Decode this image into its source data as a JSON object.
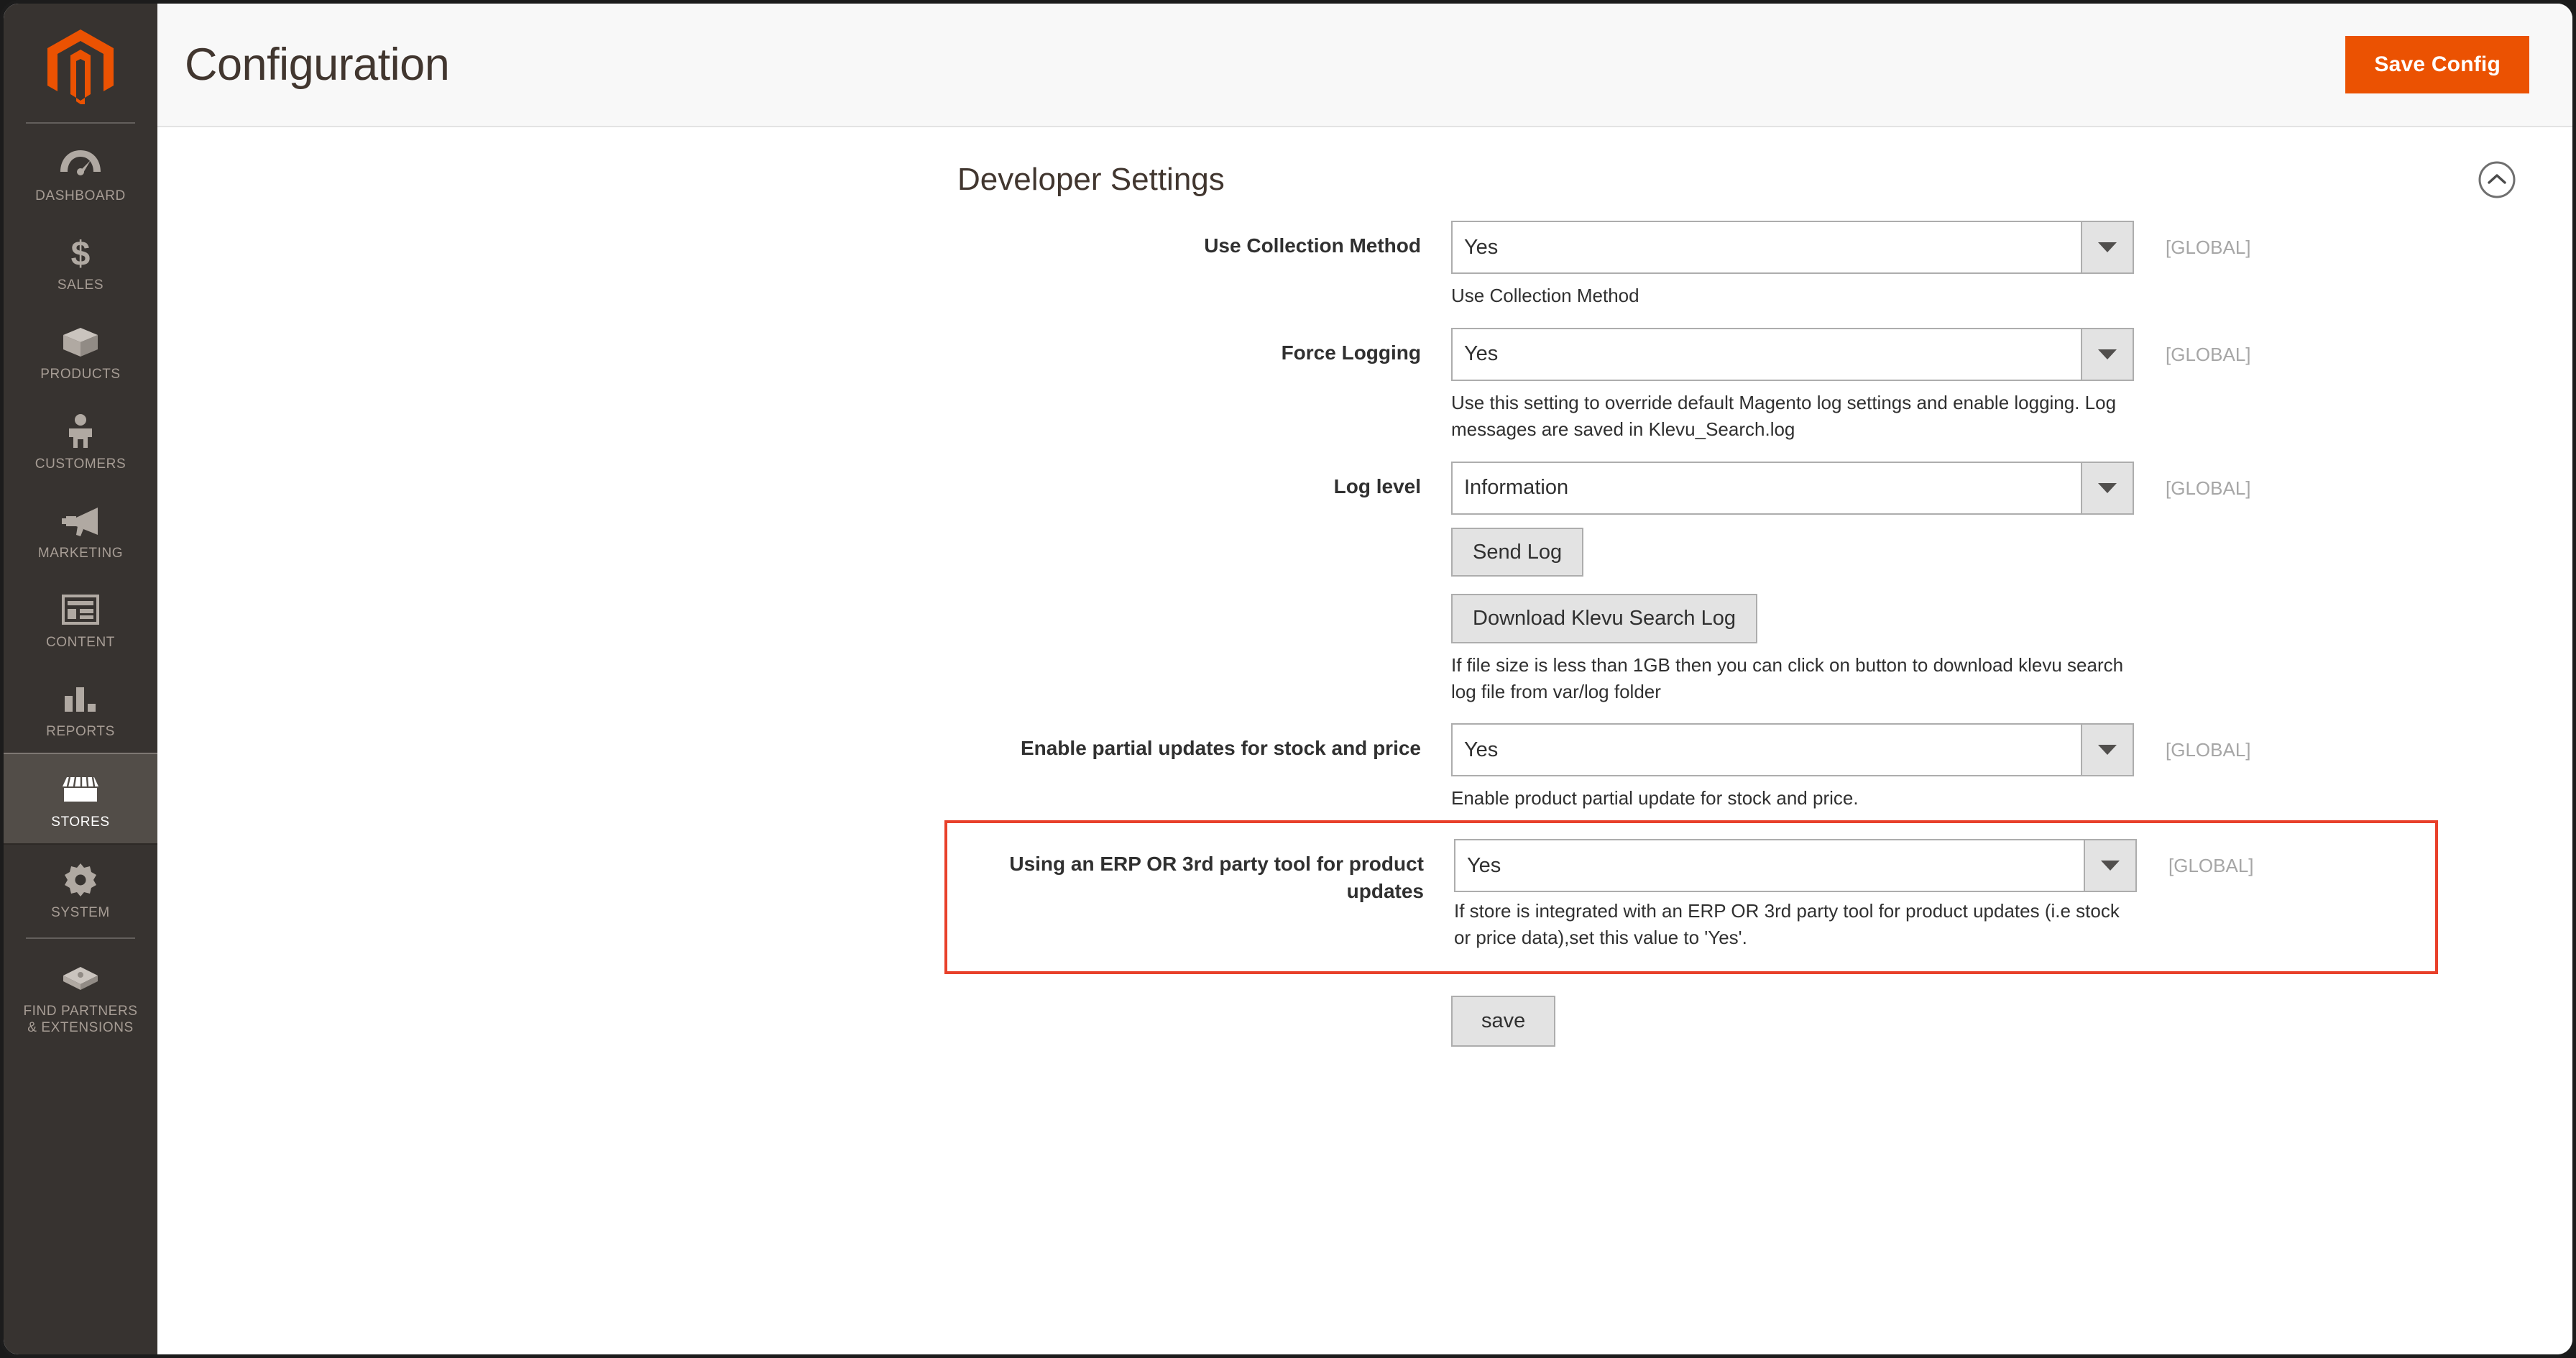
{
  "sidebar": {
    "logo": "magento-logo",
    "items": [
      {
        "label": "DASHBOARD",
        "icon": "dashboard-icon",
        "active": false
      },
      {
        "label": "SALES",
        "icon": "dollar-icon",
        "active": false
      },
      {
        "label": "PRODUCTS",
        "icon": "box-icon",
        "active": false
      },
      {
        "label": "CUSTOMERS",
        "icon": "person-icon",
        "active": false
      },
      {
        "label": "MARKETING",
        "icon": "megaphone-icon",
        "active": false
      },
      {
        "label": "CONTENT",
        "icon": "layout-icon",
        "active": false
      },
      {
        "label": "REPORTS",
        "icon": "bar-chart-icon",
        "active": false
      },
      {
        "label": "STORES",
        "icon": "storefront-icon",
        "active": true
      },
      {
        "label": "SYSTEM",
        "icon": "gear-icon",
        "active": false
      },
      {
        "label": "FIND PARTNERS\n& EXTENSIONS",
        "icon": "extensions-icon",
        "active": false
      }
    ]
  },
  "header": {
    "title": "Configuration",
    "save_config_label": "Save Config"
  },
  "section": {
    "title": "Developer Settings",
    "collapse_icon": "chevron-up-circle-icon"
  },
  "fields": [
    {
      "label": "Use Collection Method",
      "value": "Yes",
      "note": "Use Collection Method",
      "scope": "[GLOBAL]"
    },
    {
      "label": "Force Logging",
      "value": "Yes",
      "note": "Use this setting to override default Magento log settings and enable logging. Log messages are saved in Klevu_Search.log",
      "scope": "[GLOBAL]"
    },
    {
      "label": "Log level",
      "value": "Information",
      "note": "",
      "scope": "[GLOBAL]"
    },
    {
      "label": "Enable partial updates for stock and price",
      "value": "Yes",
      "note": "Enable product partial update for stock and price.",
      "scope": "[GLOBAL]"
    }
  ],
  "buttons": {
    "send_log": "Send Log",
    "download_log": "Download Klevu Search Log",
    "download_log_note": "If file size is less than 1GB then you can click on button to download klevu search log file from var/log folder",
    "save_lower": "save"
  },
  "highlighted_field": {
    "label": "Using an ERP OR 3rd party tool for product updates",
    "value": "Yes",
    "note": "If store is integrated with an ERP OR 3rd party tool for product updates (i.e stock or price data),set this value to 'Yes'.",
    "scope": "[GLOBAL]",
    "highlight_color": "#e8402a"
  },
  "colors": {
    "brand_orange": "#eb5202",
    "sidebar_bg": "#373330",
    "sidebar_active": "#524d48",
    "text_dark": "#303030",
    "scope_gray": "#a6a6a6"
  }
}
